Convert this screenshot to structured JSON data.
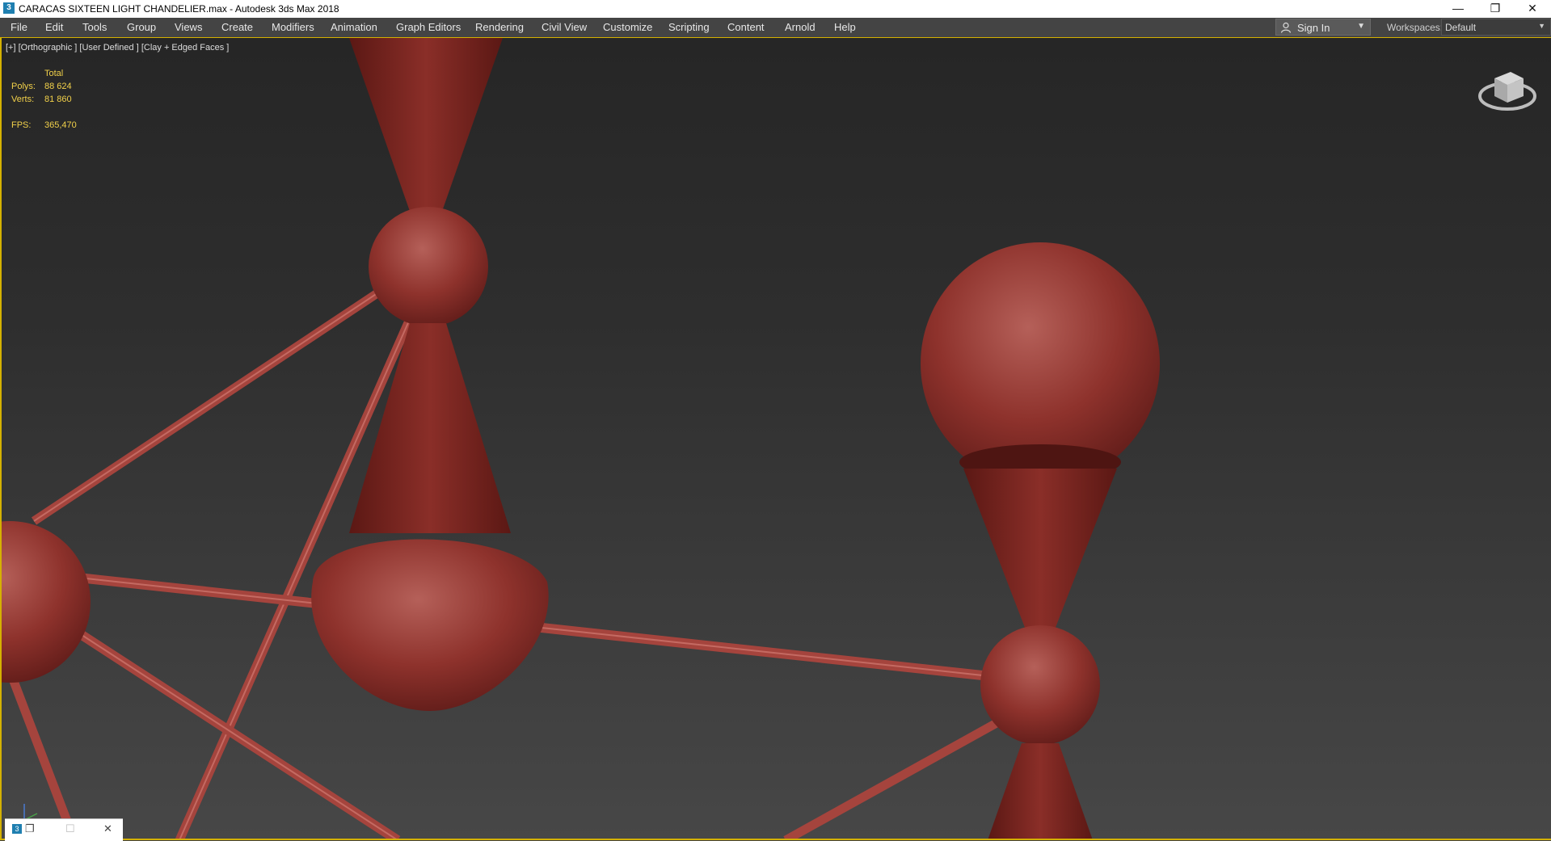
{
  "window": {
    "app_icon": "3ds-max-icon",
    "app_icon_glyph": "3",
    "title": "CARACAS SIXTEEN LIGHT CHANDELIER.max - Autodesk 3ds Max 2018",
    "minimize_glyph": "—",
    "restore_glyph": "❐",
    "close_glyph": "✕"
  },
  "menu": {
    "items": [
      "File",
      "Edit",
      "Tools",
      "Group",
      "Views",
      "Create",
      "Modifiers",
      "Animation",
      "Graph Editors",
      "Rendering",
      "Civil View",
      "Customize",
      "Scripting",
      "Content",
      "Arnold",
      "Help"
    ]
  },
  "account": {
    "user_icon": "user-icon",
    "signin_label": "Sign In",
    "caret": "▼"
  },
  "workspace": {
    "label": "Workspaces:",
    "value": "Default",
    "caret": "▼"
  },
  "viewport": {
    "label": "[+] [Orthographic ] [User Defined ] [Clay + Edged Faces ]",
    "stats": {
      "header": "Total",
      "polys_label": "Polys:",
      "polys_value": "88 624",
      "verts_label": "Verts:",
      "verts_value": "81 860",
      "fps_label": "FPS:",
      "fps_value": "365,470"
    },
    "highlight_color": "#d4b100",
    "model_color": "#9a3a34"
  },
  "mini_window": {
    "icon_glyph": "3",
    "restore_glyph": "❐",
    "maximize_glyph": "☐",
    "close_glyph": "✕"
  }
}
